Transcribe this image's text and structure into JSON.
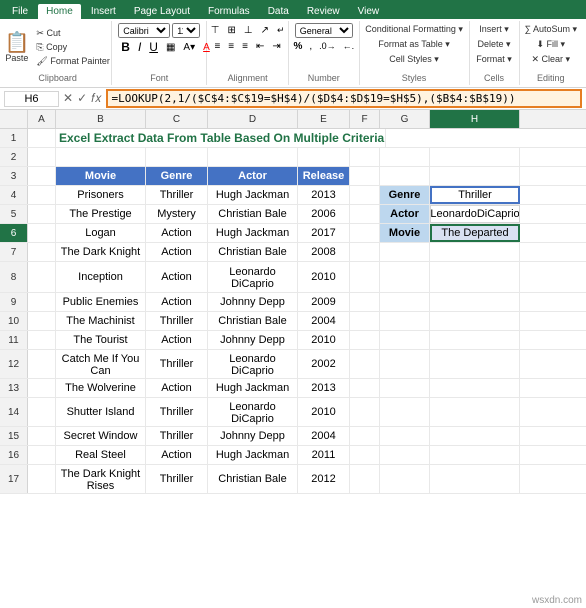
{
  "ribbon": {
    "tabs": [
      "File",
      "Home",
      "Insert",
      "Page Layout",
      "Formulas",
      "Data",
      "Review",
      "View"
    ],
    "active_tab": "Home",
    "groups": {
      "clipboard": {
        "label": "Clipboard",
        "paste": "📋"
      },
      "font": {
        "label": "Font"
      },
      "alignment": {
        "label": "Alignment"
      },
      "number": {
        "label": "Number"
      },
      "styles": {
        "label": "Styles",
        "items": [
          "Conditional Formatting ▾",
          "Format as Table ▾",
          "Cell Styles ▾"
        ]
      },
      "cells": {
        "label": "Cells"
      },
      "editing": {
        "label": "Editing"
      }
    }
  },
  "formula_bar": {
    "cell_ref": "H6",
    "formula": "=LOOKUP(2,1/($C$4:$C$19=$H$4)/($D$4:$D$19=$H$5),($B$4:$B$19))"
  },
  "title": "Excel Extract Data From Table Based On Multiple Criteria",
  "table_headers": [
    "Movie",
    "Genre",
    "Actor",
    "Release"
  ],
  "rows": [
    {
      "num": 4,
      "movie": "Prisoners",
      "genre": "Thriller",
      "actor": "Hugh Jackman",
      "release": "2013"
    },
    {
      "num": 5,
      "movie": "The Prestige",
      "genre": "Mystery",
      "actor": "Christian Bale",
      "release": "2006"
    },
    {
      "num": 6,
      "movie": "Logan",
      "genre": "Action",
      "actor": "Hugh Jackman",
      "release": "2017"
    },
    {
      "num": 7,
      "movie": "The Dark Knight",
      "genre": "Action",
      "actor": "Christian Bale",
      "release": "2008"
    },
    {
      "num": 8,
      "movie": "Inception",
      "genre": "Action",
      "actor": "Leonardo DiCaprio",
      "release": "2010"
    },
    {
      "num": 9,
      "movie": "Public Enemies",
      "genre": "Action",
      "actor": "Johnny Depp",
      "release": "2009"
    },
    {
      "num": 10,
      "movie": "The Machinist",
      "genre": "Thriller",
      "actor": "Christian Bale",
      "release": "2004"
    },
    {
      "num": 11,
      "movie": "The Tourist",
      "genre": "Action",
      "actor": "Johnny Depp",
      "release": "2010"
    },
    {
      "num": 12,
      "movie": "Catch Me If You Can",
      "genre": "Thriller",
      "actor": "Leonardo DiCaprio",
      "release": "2002"
    },
    {
      "num": 13,
      "movie": "The Wolverine",
      "genre": "Action",
      "actor": "Hugh Jackman",
      "release": "2013"
    },
    {
      "num": 14,
      "movie": "Shutter Island",
      "genre": "Thriller",
      "actor": "Leonardo DiCaprio",
      "release": "2010"
    },
    {
      "num": 15,
      "movie": "Secret Window",
      "genre": "Thriller",
      "actor": "Johnny Depp",
      "release": "2004"
    },
    {
      "num": 16,
      "movie": "Real Steel",
      "genre": "Action",
      "actor": "Hugh Jackman",
      "release": "2011"
    },
    {
      "num": 17,
      "movie": "The Dark Knight Rises",
      "genre": "Thriller",
      "actor": "Christian Bale",
      "release": "2012"
    }
  ],
  "lookup": {
    "genre_label": "Genre",
    "genre_value": "Thriller",
    "actor_label": "Actor",
    "actor_line1": "Leonardo",
    "actor_line2": "DiCaprio",
    "movie_label": "Movie",
    "movie_value": "The Departed"
  },
  "watermark": "wsxdn.com",
  "col_headers": [
    "",
    "A",
    "B",
    "C",
    "D",
    "E",
    "F",
    "G",
    "H"
  ]
}
